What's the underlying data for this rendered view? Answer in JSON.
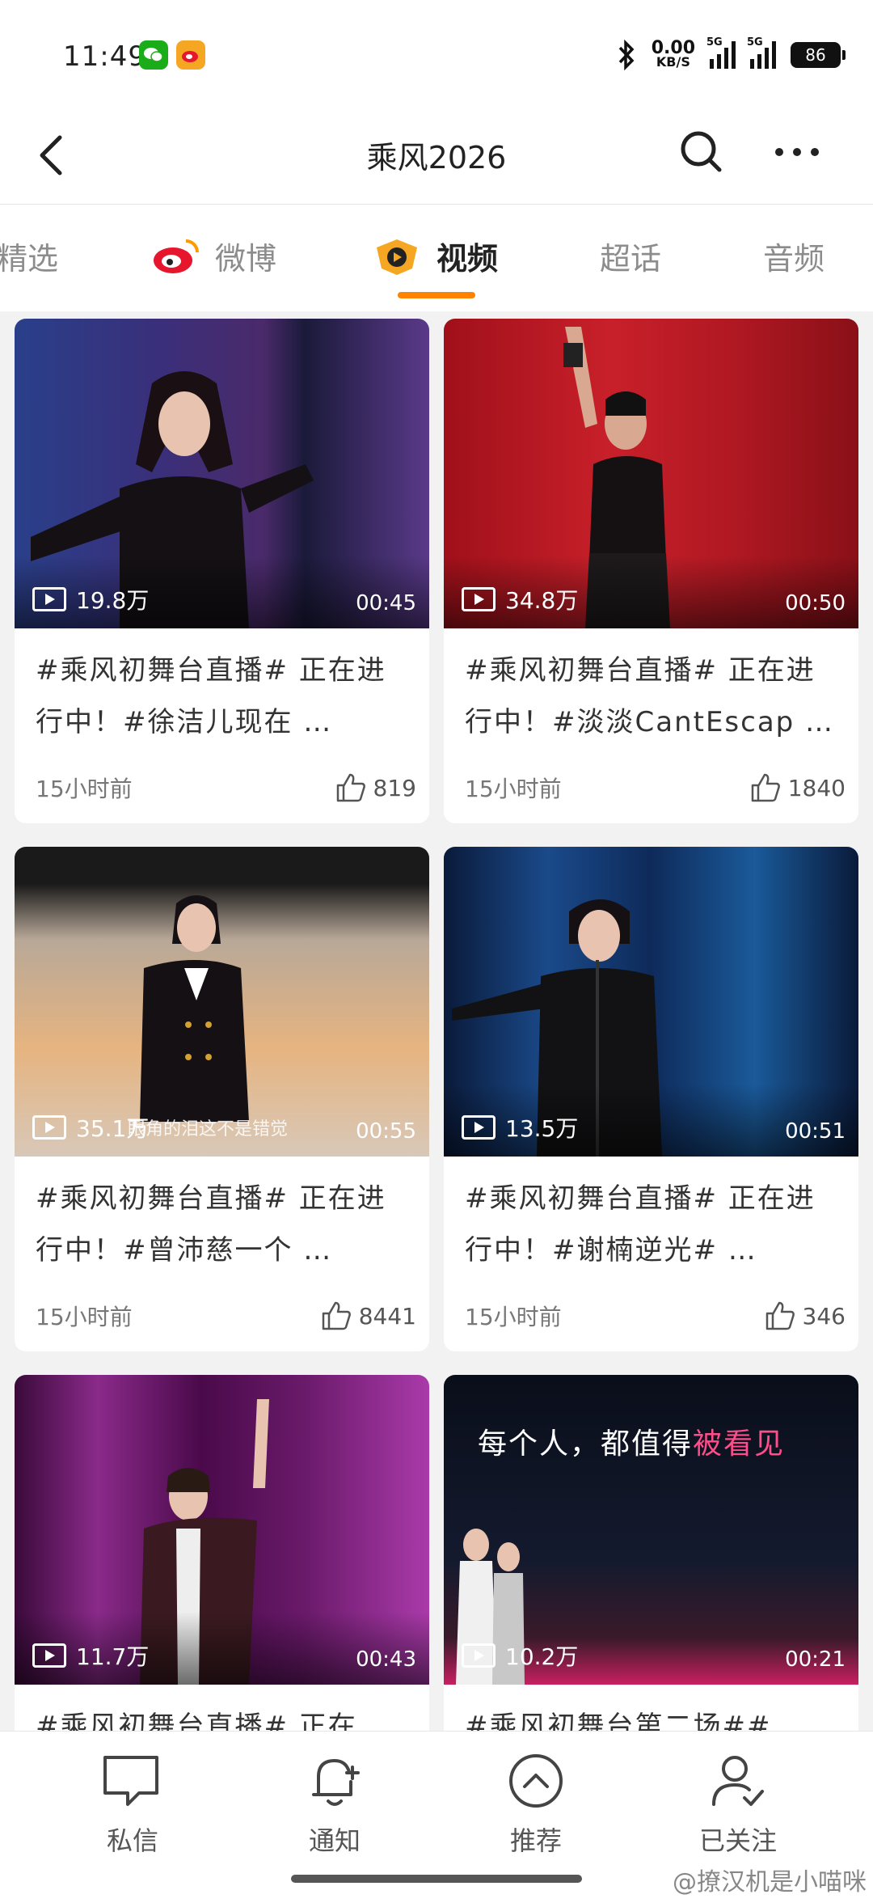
{
  "status_bar": {
    "time": "11:49",
    "net_speed_value": "0.00",
    "net_speed_unit": "KB/S",
    "signal1_label": "5G",
    "signal2_label": "5G",
    "battery": "86",
    "icons": [
      "wechat-icon",
      "weibo-icon",
      "bluetooth-icon",
      "signal-icon",
      "battery-icon"
    ]
  },
  "header": {
    "title": "乘风2026"
  },
  "tabs": [
    {
      "label": "精选",
      "active": false
    },
    {
      "label": "微博",
      "active": false
    },
    {
      "label": "视频",
      "active": true
    },
    {
      "label": "超话",
      "active": false
    },
    {
      "label": "音频",
      "active": false
    }
  ],
  "colors": {
    "accent": "#ff8200",
    "page_bg": "#f2f2f2"
  },
  "videos": [
    {
      "views": "19.8万",
      "duration": "00:45",
      "title": "#乘风初舞台直播# 正在进行中！#徐洁儿现在 …",
      "time": "15小时前",
      "likes": "819"
    },
    {
      "views": "34.8万",
      "duration": "00:50",
      "title": "#乘风初舞台直播# 正在进行中！#淡淡CantEscap …",
      "time": "15小时前",
      "likes": "1840"
    },
    {
      "views": "35.1万",
      "duration": "00:55",
      "title": "#乘风初舞台直播# 正在进行中！#曾沛慈一个 …",
      "time": "15小时前",
      "likes": "8441",
      "overlay": "眼角的泪这不是错觉"
    },
    {
      "views": "13.5万",
      "duration": "00:51",
      "title": "#乘风初舞台直播# 正在进行中！#谢楠逆光# …",
      "time": "15小时前",
      "likes": "346"
    },
    {
      "views": "11.7万",
      "duration": "00:43",
      "title": "#乘风初舞台直播# 正在"
    },
    {
      "views": "10.2万",
      "duration": "00:21",
      "title": "#乘风初舞台第二场##",
      "overlay_white": "每个人，都值得",
      "overlay_pink": "被看见"
    }
  ],
  "bottom_nav": [
    {
      "label": "私信",
      "icon": "message-icon"
    },
    {
      "label": "通知",
      "icon": "bell-icon"
    },
    {
      "label": "推荐",
      "icon": "chevron-up-circle-icon"
    },
    {
      "label": "已关注",
      "icon": "user-check-icon"
    }
  ],
  "watermark": "@撩汉机是小喵咪"
}
